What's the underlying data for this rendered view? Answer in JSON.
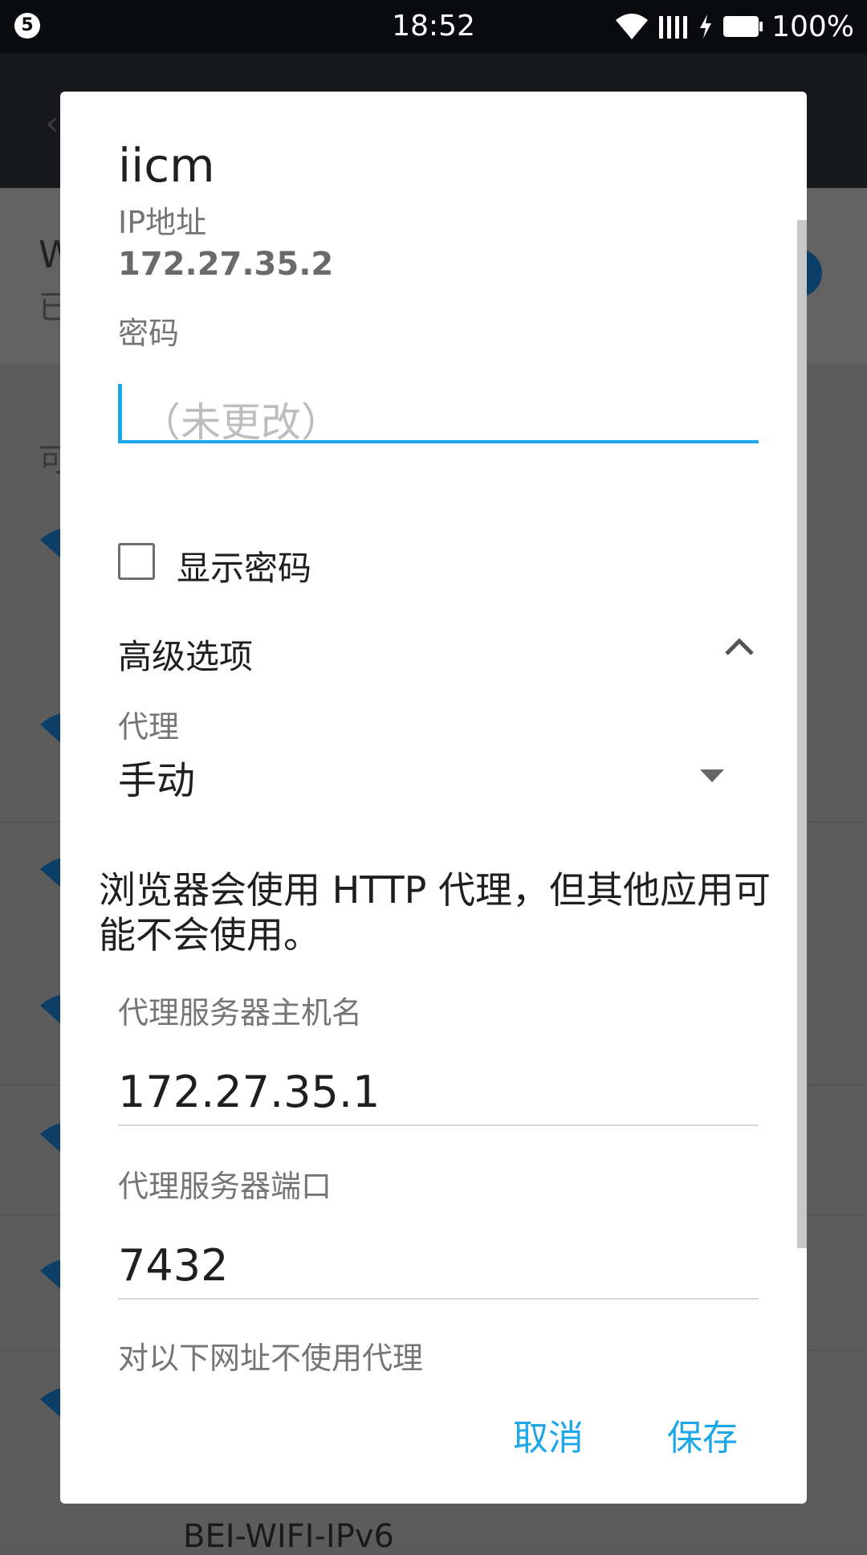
{
  "status_bar": {
    "notification_count": "5",
    "time": "18:52",
    "battery": "100%"
  },
  "background": {
    "header_title_partial": "W",
    "header_sub_partial": "已",
    "available_partial": "可",
    "bottom_network_partial": "BEI-WIFI-IPv6"
  },
  "dialog": {
    "title": "iicm",
    "ip_label": "IP地址",
    "ip_value": "172.27.35.2",
    "password_label": "密码",
    "password_placeholder": "（未更改）",
    "show_password_label": "显示密码",
    "advanced_label": "高级选项",
    "proxy_label": "代理",
    "proxy_value": "手动",
    "proxy_warning": "浏览器会使用 HTTP 代理，但其他应用可能不会使用。",
    "hostname_label": "代理服务器主机名",
    "hostname_value": "172.27.35.1",
    "port_label": "代理服务器端口",
    "port_value": "7432",
    "bypass_label": "对以下网址不使用代理",
    "cancel": "取消",
    "save": "保存"
  },
  "colors": {
    "accent": "#1ea7e8",
    "status_bar_bg": "#0a0b0f",
    "scrim": "#5a5a5a"
  }
}
